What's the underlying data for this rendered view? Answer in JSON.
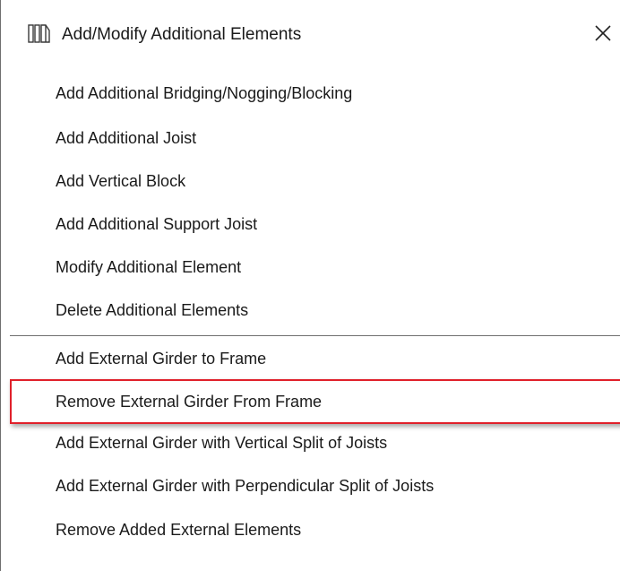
{
  "dialog": {
    "title": "Add/Modify Additional Elements",
    "icon": "frame-elements-icon",
    "close_icon": "close-icon"
  },
  "menu": {
    "group1": [
      {
        "label": "Add Additional Bridging/Nogging/Blocking"
      },
      {
        "label": "Add Additional Joist"
      },
      {
        "label": "Add Vertical Block"
      },
      {
        "label": "Add Additional Support Joist"
      },
      {
        "label": "Modify Additional Element"
      },
      {
        "label": "Delete Additional Elements"
      }
    ],
    "group2": [
      {
        "label": "Add External Girder to Frame"
      },
      {
        "label": "Remove External Girder From Frame"
      },
      {
        "label": "Add External Girder with Vertical Split of Joists"
      },
      {
        "label": "Add External Girder with Perpendicular Split of Joists"
      },
      {
        "label": "Remove Added External Elements"
      }
    ],
    "highlighted_item": "Remove External Girder From Frame"
  },
  "colors": {
    "highlight_border": "#e0202a",
    "divider": "#6f6f6f",
    "text": "#1a1a1a"
  }
}
